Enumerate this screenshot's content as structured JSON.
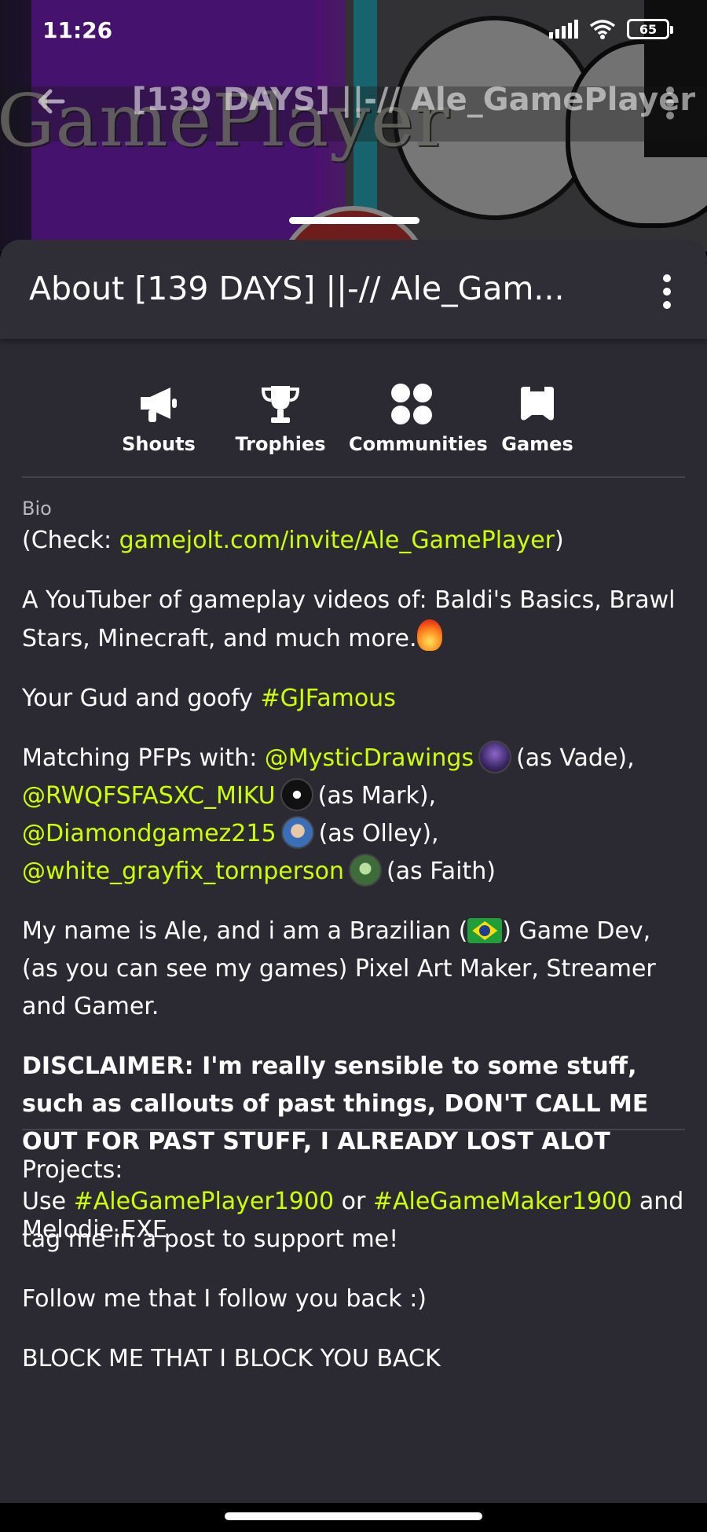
{
  "status_bar": {
    "time": "11:26",
    "battery": "65"
  },
  "top_nav": {
    "title": "[139 DAYS] ||-// Ale_GamePlayer"
  },
  "banner": {
    "text": "GamePlayer"
  },
  "sheet": {
    "title": "About [139 DAYS] ||-// Ale_Gam...",
    "tabs": [
      {
        "label": "Shouts",
        "icon": "megaphone-icon"
      },
      {
        "label": "Trophies",
        "icon": "trophy-icon"
      },
      {
        "label": "Communities",
        "icon": "communities-icon"
      },
      {
        "label": "Games",
        "icon": "gamepad-icon"
      }
    ]
  },
  "bio": {
    "label": "Bio",
    "check_prefix": "(Check: ",
    "check_link": "gamejolt.com/invite/Ale_GamePlayer",
    "check_suffix": ")",
    "youtuber": "A YouTuber of gameplay videos of: Baldi's Basics, Brawl Stars, Minecraft, and much more.",
    "goofy_prefix": "Your Gud and goofy ",
    "goofy_tag": "#GJFamous",
    "matching_prefix": "Matching PFPs with: ",
    "matches": [
      {
        "user": "@MysticDrawings",
        "as": "(as Vade),"
      },
      {
        "user": "@RWQFSFASXC_MIKU",
        "as": "(as Mark),"
      },
      {
        "user": "@Diamondgamez215",
        "as": "(as Olley),"
      },
      {
        "user": "@white_grayfix_tornperson",
        "as": "(as Faith)"
      }
    ],
    "name_before_flag": "My name is Ale, and i am a Brazilian (",
    "name_after_flag": ") Game Dev, (as you can see my games) Pixel Art Maker, Streamer and Gamer.",
    "disclaimer": "DISCLAIMER: I'm really sensible to some stuff, such as callouts of past things, DON'T CALL ME OUT FOR PAST STUFF,  I ALREADY LOST ALOT",
    "use_prefix": "Use ",
    "tag1": "#AleGamePlayer1900",
    "use_or": " or ",
    "tag2": "#AleGameMaker1900",
    "use_suffix": " and tag me in a post to support me!",
    "follow": "Follow me that I follow you back :)",
    "block": "BLOCK ME THAT I BLOCK YOU BACK",
    "projects": "Projects:",
    "project_partial": "Melodie.EXE"
  },
  "colors": {
    "accent": "#ccff00",
    "sheet_bg": "#2b2a33",
    "header_bg": "#2f2e37"
  }
}
